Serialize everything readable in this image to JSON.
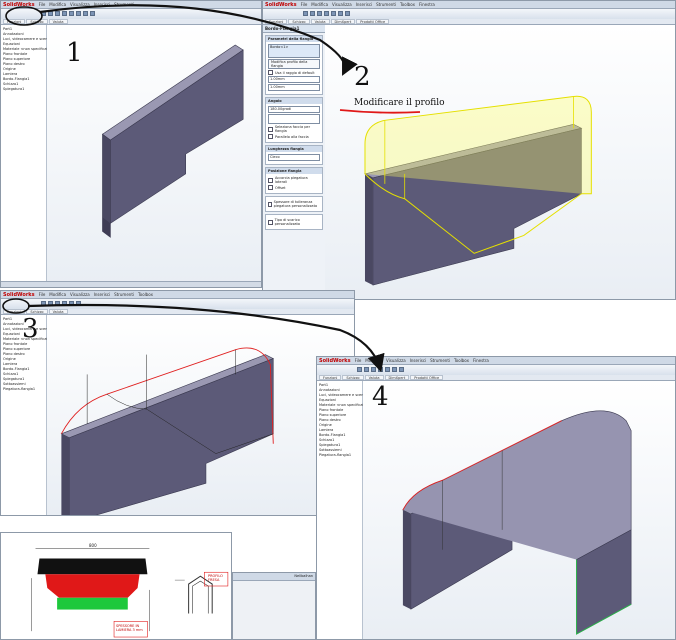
{
  "app": {
    "logo": "SolidWorks",
    "menus": [
      "File",
      "Modifica",
      "Visualizza",
      "Inserisci",
      "Strumenti",
      "Toolbox",
      "Finestra",
      "?"
    ]
  },
  "tabs": [
    "Funzioni",
    "Schizzo",
    "Valuta",
    "DimXpert",
    "Prodotti Office"
  ],
  "tree": {
    "items": [
      "Part1",
      "Annotazioni",
      "Luci, videocamere e scenepiani",
      "Equazioni",
      "Materiale <non specificato>",
      "Piano frontale",
      "Piano superiore",
      "Piano destro",
      "Origine",
      "Lamiera",
      "Bordo-Flangia1",
      "Schizzo1",
      "Spiegatura1",
      "Sottoassiemi",
      "Piegatura-flangia1"
    ]
  },
  "steps": {
    "s1": "1",
    "s2": "2",
    "s3": "3",
    "s4": "4"
  },
  "annotation": {
    "text": "Modificare il profilo"
  },
  "pm": {
    "title": "Bordo-Flangia1",
    "params_title": "Parametri della flangia",
    "edge_label": "Bordo<1>",
    "edit_profile": "Modifica profilo della flangia",
    "use_default_radius": "Usa il raggio di default",
    "radius_value": "1.00mm",
    "gap_value": "1.00mm",
    "angle_title": "Angolo",
    "angle_value": "180.00gradi",
    "selection_face_label": "Seleziona faccia per flangia",
    "parallel_face_label": "Parallelo alla faccia",
    "length_title": "Lunghezza flangia",
    "length_value": "Cieco",
    "position_title": "Posizione flangia",
    "trim_side": "Accorcia piegatura laterali",
    "offset": "Offset",
    "relief_title": "Spessore di tolleranza piegatura personalizzato",
    "relief_type": "Tipo di scarico personalizzato"
  },
  "inset": {
    "dim_top": "800",
    "label_top": "PROFILO FRESA",
    "label_bottom": "SPESSORE IN LAMIERA 3 mm",
    "title": "Nellbalhan"
  },
  "colors": {
    "accent": "#c00000",
    "arrow": "#111111",
    "part": "#5c5a78",
    "highlight": "#ffff00",
    "edge_red": "#e02020",
    "edge_green": "#2bb34a"
  }
}
